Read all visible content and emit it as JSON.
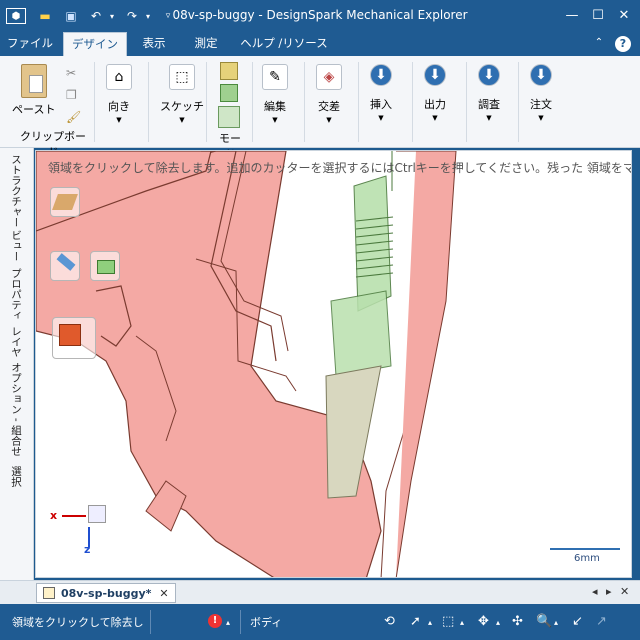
{
  "window": {
    "title": "08v-sp-buggy - DesignSpark Mechanical Explorer",
    "minimize": "—",
    "maximize": "☐",
    "close": "✕"
  },
  "quick_access": {
    "app_icon": "cube-icon",
    "open": "folder-icon",
    "save": "save-icon",
    "undo": "undo-icon",
    "redo": "redo-icon",
    "customize": "chevron-down-icon"
  },
  "menu": {
    "tabs": [
      "ファイル",
      "デザイン",
      "表示",
      "測定",
      "ヘルプ /リソース"
    ],
    "active": "デザイン",
    "help_chevron": "⌃",
    "help_icon": "?"
  },
  "ribbon": {
    "clipboard": {
      "paste": "ペースト",
      "group_label": "クリップボード"
    },
    "orient": "向き",
    "sketch": "スケッチ",
    "mode": "モード",
    "edit": "編集",
    "intersect": "交差",
    "insert": "挿入",
    "output": "出力",
    "inspect": "調査",
    "order": "注文"
  },
  "sidebar": {
    "tabs": [
      "ストラクチャー",
      "ビュー",
      "プロパティ",
      "レイヤ",
      "オプション - 組合せ",
      "選択"
    ]
  },
  "viewport": {
    "hint": "領域をクリックして除去します。追加のカッターを選択するにはCtrlキーを押してください。残った 領域をマ",
    "scale_label": "6mm",
    "axis_x": "x",
    "axis_z": "z"
  },
  "doc_tabs": {
    "active": "08v-sp-buggy*",
    "close": "✕",
    "nav_left": "◂",
    "nav_right": "▸"
  },
  "status": {
    "message": "領域をクリックして除去し",
    "body_label": "ボディ"
  },
  "colors": {
    "title_bar": "#1f5b92",
    "ribbon_bg": "#f4f6f9",
    "part_fill": "#f4a9a4",
    "part_edge": "#7a3b30",
    "tool_green": "#b9e0ad"
  }
}
